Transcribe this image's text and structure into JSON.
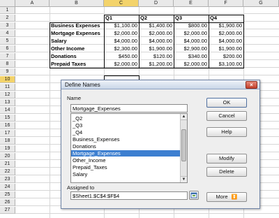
{
  "columns": [
    "A",
    "B",
    "C",
    "D",
    "E",
    "F",
    "G"
  ],
  "selected_column": "C",
  "rows": [
    "1",
    "2",
    "3",
    "4",
    "5",
    "6",
    "7",
    "8",
    "9",
    "10",
    "11",
    "12",
    "13",
    "14",
    "15",
    "16",
    "17",
    "18",
    "19",
    "20",
    "21",
    "22",
    "23",
    "24",
    "25",
    "26",
    "27"
  ],
  "selected_row": "10",
  "headers": {
    "c": "Q1",
    "d": "Q2",
    "e": "Q3",
    "f": "Q4"
  },
  "data_rows": [
    {
      "label": "Business Expenses",
      "c": "$1,100.00",
      "d": "$1,400.00",
      "e": "$800.00",
      "f": "$1,900.00"
    },
    {
      "label": "Mortgage Expenses",
      "c": "$2,000.00",
      "d": "$2,000.00",
      "e": "$2,000.00",
      "f": "$2,000.00"
    },
    {
      "label": "Salary",
      "c": "$4,000.00",
      "d": "$4,000.00",
      "e": "$4,000.00",
      "f": "$4,000.00"
    },
    {
      "label": "Other Income",
      "c": "$2,300.00",
      "d": "$1,900.00",
      "e": "$2,900.00",
      "f": "$1,900.00"
    },
    {
      "label": "Donations",
      "c": "$450.00",
      "d": "$120.00",
      "e": "$340.00",
      "f": "$200.00"
    },
    {
      "label": "Prepaid Taxes",
      "c": "$2,000.00",
      "d": "$1,200.00",
      "e": "$2,000.00",
      "f": "$3,100.00"
    }
  ],
  "dialog": {
    "title": "Define Names",
    "close_glyph": "×",
    "name_label": "Name",
    "name_value": "Mortgage_Expenses",
    "names": [
      "_Q2",
      "_Q3",
      "_Q4",
      "Business_Expenses",
      "Donations",
      "Mortgage_Expenses",
      "Other_Income",
      "Prepaid_Taxes",
      "Salary"
    ],
    "selected_name": "Mortgage_Expenses",
    "assigned_label": "Assigned to",
    "assigned_value": "$Sheet1.$C$4:$F$4",
    "buttons": {
      "ok": "OK",
      "cancel": "Cancel",
      "help": "Help",
      "modify": "Modify",
      "delete": "Delete",
      "more": "More"
    },
    "more_icon": "double-chevron-down-icon",
    "shrink_icon": "shrink-reference-icon",
    "selection_color": "#3d7fd0"
  }
}
